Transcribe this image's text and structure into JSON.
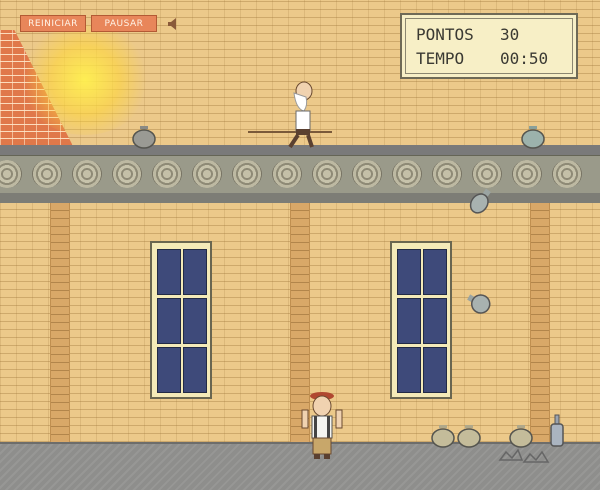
{
  "buttons": {
    "restart": "REINICIAR",
    "pause": "PAUSAR"
  },
  "sound_icon": "speaker-icon",
  "hud": {
    "points_label": "PONTOS",
    "points_value": "30",
    "time_label": "TEMPO",
    "time_value": "00:50"
  },
  "colors": {
    "button": "#e8865a",
    "hud_bg": "#f7efc6",
    "wall": "#ecc98a",
    "window_glass": "#3e4a7a"
  }
}
